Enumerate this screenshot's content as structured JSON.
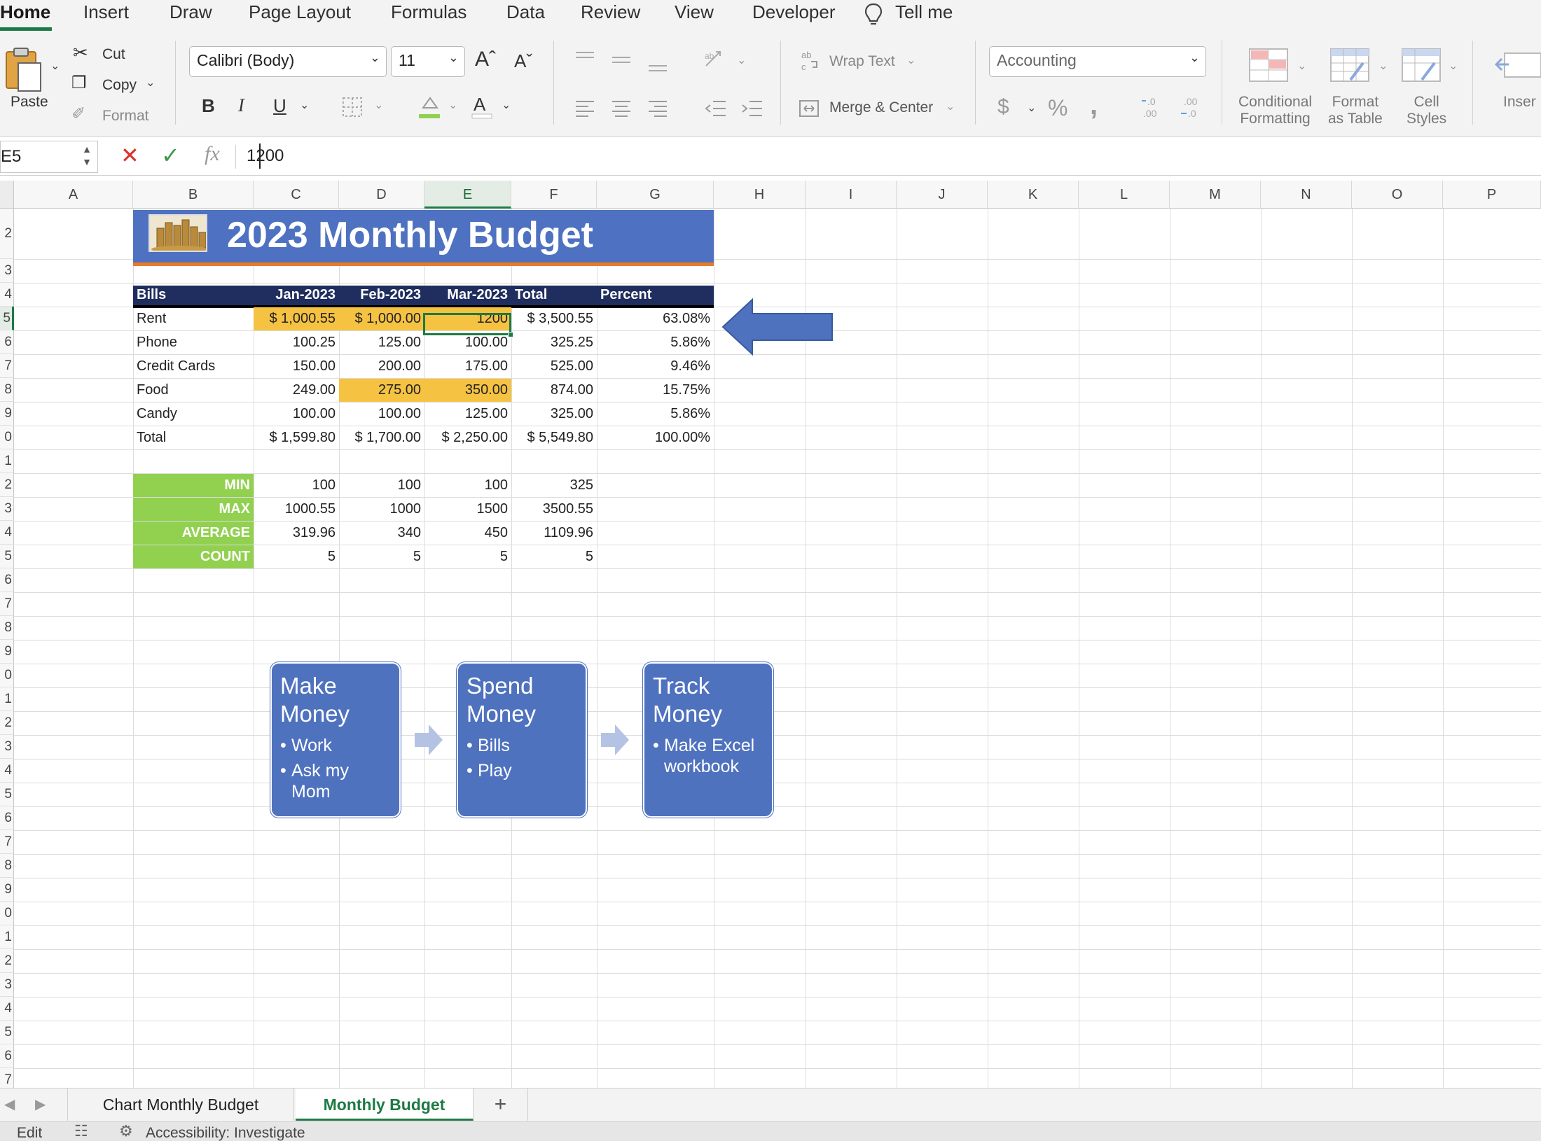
{
  "menu": {
    "tabs": [
      "Home",
      "Insert",
      "Draw",
      "Page Layout",
      "Formulas",
      "Data",
      "Review",
      "View",
      "Developer"
    ],
    "tell_me": "Tell me"
  },
  "ribbon": {
    "paste": "Paste",
    "cut": "Cut",
    "copy": "Copy",
    "format": "Format",
    "font_name": "Calibri (Body)",
    "font_size": "11",
    "bold": "B",
    "italic": "I",
    "underline": "U",
    "wrap_text": "Wrap Text",
    "merge_center": "Merge & Center",
    "number_format": "Accounting",
    "currency": "$",
    "percent": "%",
    "comma": ",",
    "conditional_formatting": [
      "Conditional",
      "Formatting"
    ],
    "format_as_table": [
      "Format",
      "as Table"
    ],
    "cell_styles": [
      "Cell",
      "Styles"
    ],
    "insert": "Inser"
  },
  "formula_bar": {
    "name_box": "E5",
    "fx": "fx",
    "value": "1200"
  },
  "columns": [
    "A",
    "B",
    "C",
    "D",
    "E",
    "F",
    "G",
    "H",
    "I",
    "J",
    "K",
    "L",
    "M",
    "N",
    "O",
    "P"
  ],
  "selected_column": "E",
  "row_numbers": [
    "2",
    "3",
    "4",
    "5",
    "6",
    "7",
    "8",
    "9",
    "0",
    "1",
    "2",
    "3",
    "4",
    "5",
    "6",
    "7",
    "8",
    "9",
    "0",
    "1",
    "2",
    "3",
    "4",
    "5",
    "6",
    "7",
    "8",
    "9",
    "0",
    "1",
    "2",
    "3",
    "4",
    "5",
    "6",
    "7"
  ],
  "sheet": {
    "title": "2023 Monthly Budget",
    "headers": [
      "Bills",
      "Jan-2023",
      "Feb-2023",
      "Mar-2023",
      "Total",
      "Percent"
    ],
    "rows": [
      [
        "Rent",
        "$ 1,000.55",
        "$ 1,000.00",
        "1200",
        "$ 3,500.55",
        "63.08%"
      ],
      [
        "Phone",
        "100.25",
        "125.00",
        "100.00",
        "325.25",
        "5.86%"
      ],
      [
        "Credit Cards",
        "150.00",
        "200.00",
        "175.00",
        "525.00",
        "9.46%"
      ],
      [
        "Food",
        "249.00",
        "275.00",
        "350.00",
        "874.00",
        "15.75%"
      ],
      [
        "Candy",
        "100.00",
        "100.00",
        "125.00",
        "325.00",
        "5.86%"
      ],
      [
        "Total",
        "$ 1,599.80",
        "$ 1,700.00",
        "$ 2,250.00",
        "$ 5,549.80",
        "100.00%"
      ]
    ],
    "stats": [
      [
        "MIN",
        "100",
        "100",
        "100",
        "325"
      ],
      [
        "MAX",
        "1000.55",
        "1000",
        "1500",
        "3500.55"
      ],
      [
        "AVERAGE",
        "319.96",
        "340",
        "450",
        "1109.96"
      ],
      [
        "COUNT",
        "5",
        "5",
        "5",
        "5"
      ]
    ]
  },
  "smartart": [
    {
      "title": "Make Money",
      "bullets": [
        "Work",
        "Ask my Mom"
      ]
    },
    {
      "title": "Spend Money",
      "bullets": [
        "Bills",
        "Play"
      ]
    },
    {
      "title": "Track Money",
      "bullets": [
        "Make Excel workbook"
      ]
    }
  ],
  "sheet_tabs": [
    "Chart Monthly Budget",
    "Monthly Budget"
  ],
  "active_sheet": "Monthly Budget",
  "add_sheet": "+",
  "status": {
    "mode": "Edit",
    "accessibility": "Accessibility: Investigate"
  },
  "colors": {
    "accent_green": "#1d7a44",
    "title_blue": "#4e72c1",
    "header_navy": "#1f2e5e",
    "highlight_yellow": "#f5c242",
    "stat_green": "#92d050",
    "title_underline_orange": "#e97b28",
    "smartart_blue": "#4f72bf"
  }
}
